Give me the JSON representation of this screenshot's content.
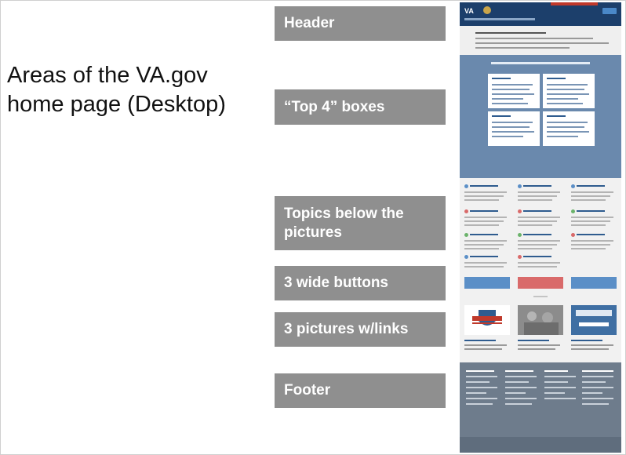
{
  "title": "Areas of the VA.gov home page (Desktop)",
  "labels": {
    "header": "Header",
    "top4": "“Top 4” boxes",
    "topics": "Topics below the pictures",
    "wide_buttons": "3 wide buttons",
    "pictures": "3 pictures w/links",
    "footer": "Footer"
  },
  "screenshot": {
    "logo": "VA",
    "colors": {
      "header": "#1c3f6b",
      "top4_band": "#6a89ad",
      "footer": "#6e7c8c",
      "wide_button_1": "#5b8fc7",
      "wide_button_2": "#d96a6a",
      "wide_button_3": "#5b8fc7"
    }
  }
}
